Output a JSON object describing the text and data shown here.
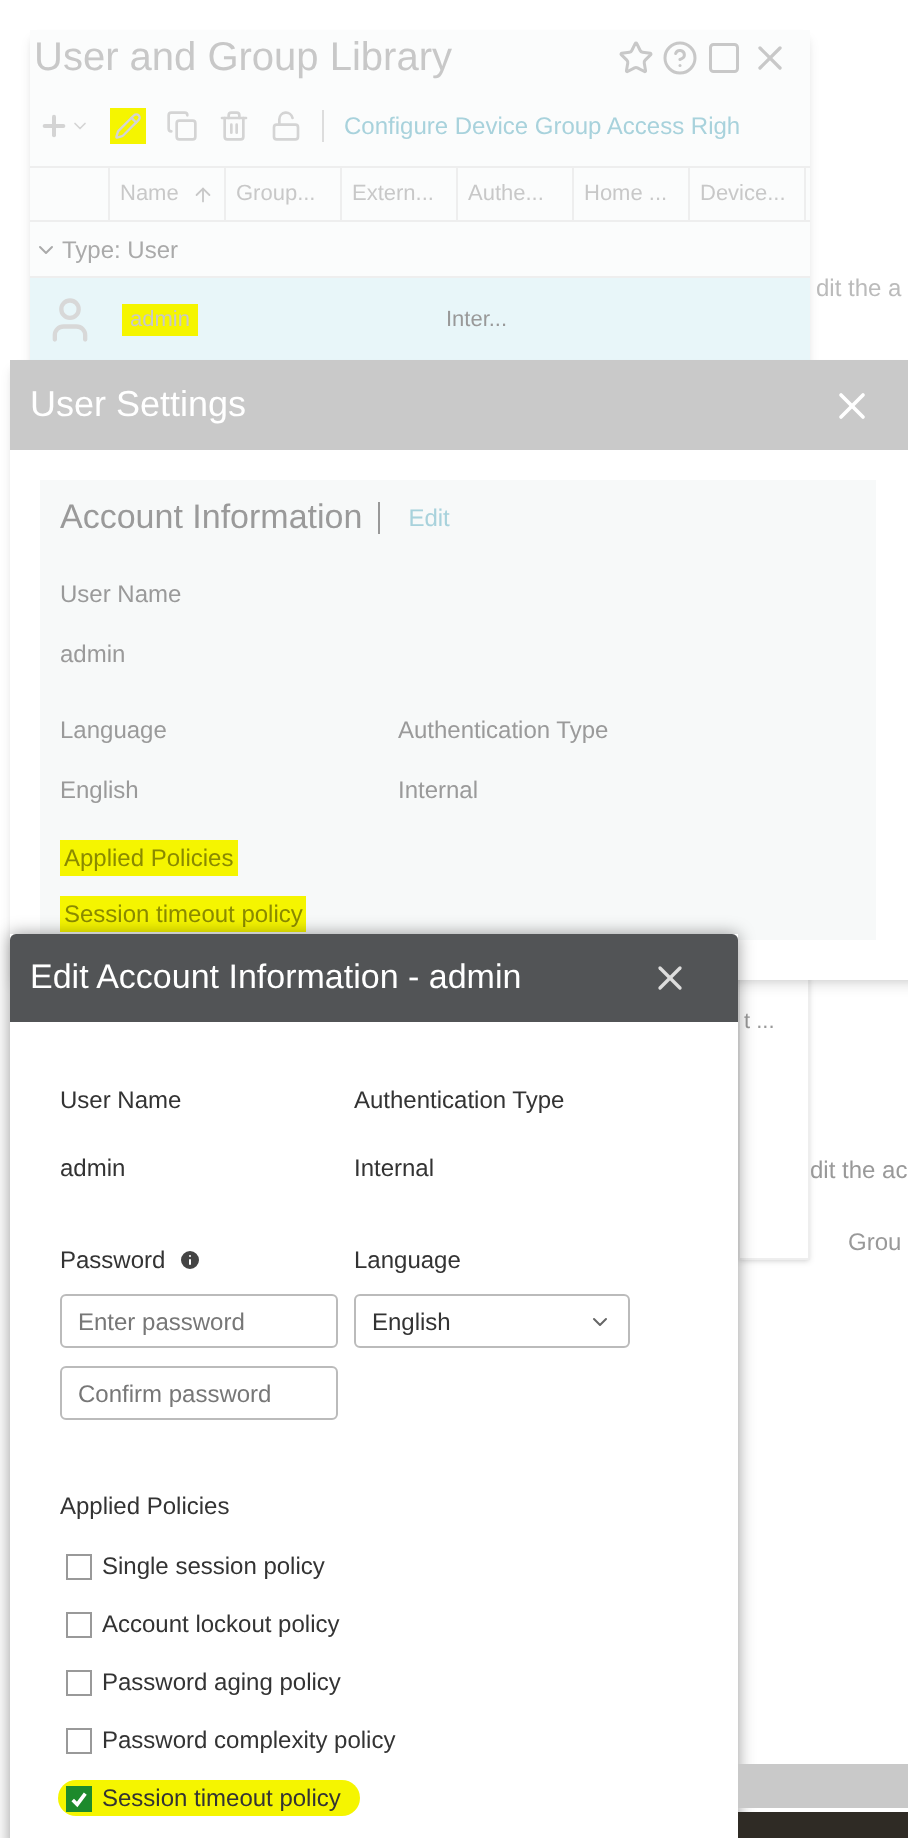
{
  "background": {
    "fragments": [
      "dit the a",
      "t ...",
      "dit the ac",
      "Grou"
    ]
  },
  "library": {
    "title": "User and Group Library",
    "toolbar_link": "Configure Device Group Access Righ",
    "edit_highlighted": true,
    "columns": [
      {
        "label": "Name",
        "sorted": true
      },
      {
        "label": "Group...",
        "sorted": false
      },
      {
        "label": "Extern...",
        "sorted": false
      },
      {
        "label": "Authe...",
        "sorted": false
      },
      {
        "label": "Home ...",
        "sorted": false
      },
      {
        "label": "Device...",
        "sorted": false
      }
    ],
    "group": {
      "label": "Type: User",
      "expanded": true
    },
    "rows": [
      {
        "name": "admin",
        "auth": "Inter...",
        "selected": true,
        "highlighted": true
      }
    ]
  },
  "user_settings": {
    "title": "User Settings",
    "section": "Account Information",
    "edit_link": "Edit",
    "fields": [
      {
        "label": "User Name",
        "value": "admin",
        "highlighted": false
      }
    ],
    "pairs": [
      {
        "label": "Language",
        "value": "English"
      },
      {
        "label": "Authentication Type",
        "value": "Internal"
      }
    ],
    "policies": {
      "label": "Applied Policies",
      "value": "Session timeout policy",
      "highlighted": true
    }
  },
  "dialog": {
    "title": "Edit Account Information - admin",
    "info": [
      {
        "label": "User Name",
        "value": "admin"
      },
      {
        "label": "Authentication Type",
        "value": "Internal"
      }
    ],
    "password_label": "Password",
    "password_placeholder": "Enter password",
    "confirm_placeholder": "Confirm password",
    "language_label": "Language",
    "language_value": "English",
    "policies_label": "Applied Policies",
    "policies": [
      {
        "label": "Single session policy",
        "checked": false,
        "highlighted": false
      },
      {
        "label": "Account lockout policy",
        "checked": false,
        "highlighted": false
      },
      {
        "label": "Password aging policy",
        "checked": false,
        "highlighted": false
      },
      {
        "label": "Password complexity policy",
        "checked": false,
        "highlighted": false
      },
      {
        "label": "Session timeout policy",
        "checked": true,
        "highlighted": true
      }
    ]
  }
}
